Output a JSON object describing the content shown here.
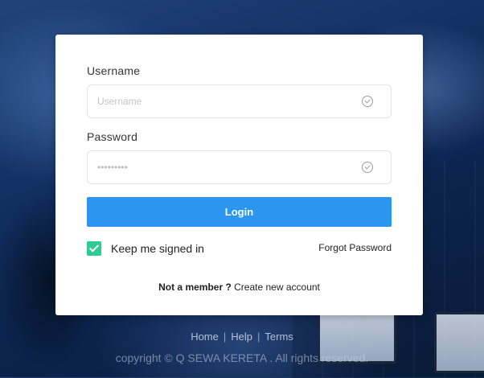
{
  "form": {
    "username_label": "Username",
    "username_placeholder": "Username",
    "password_label": "Password",
    "password_value": "•••••••••",
    "login_label": "Login",
    "keep_signed_label": "Keep me signed in",
    "keep_signed_checked": true,
    "forgot_label": "Forgot Password",
    "not_member_label": "Not a member ?",
    "create_account_label": "Create new account"
  },
  "icons": {
    "username_status": "check-circle-icon",
    "password_status": "check-circle-icon",
    "checkbox": "checkmark-icon"
  },
  "footer": {
    "links": [
      "Home",
      "Help",
      "Terms"
    ],
    "copyright": "copyright © Q SEWA KERETA . All rights reserved."
  },
  "colors": {
    "accent": "#2b95f0",
    "checkbox": "#2ecc94"
  }
}
